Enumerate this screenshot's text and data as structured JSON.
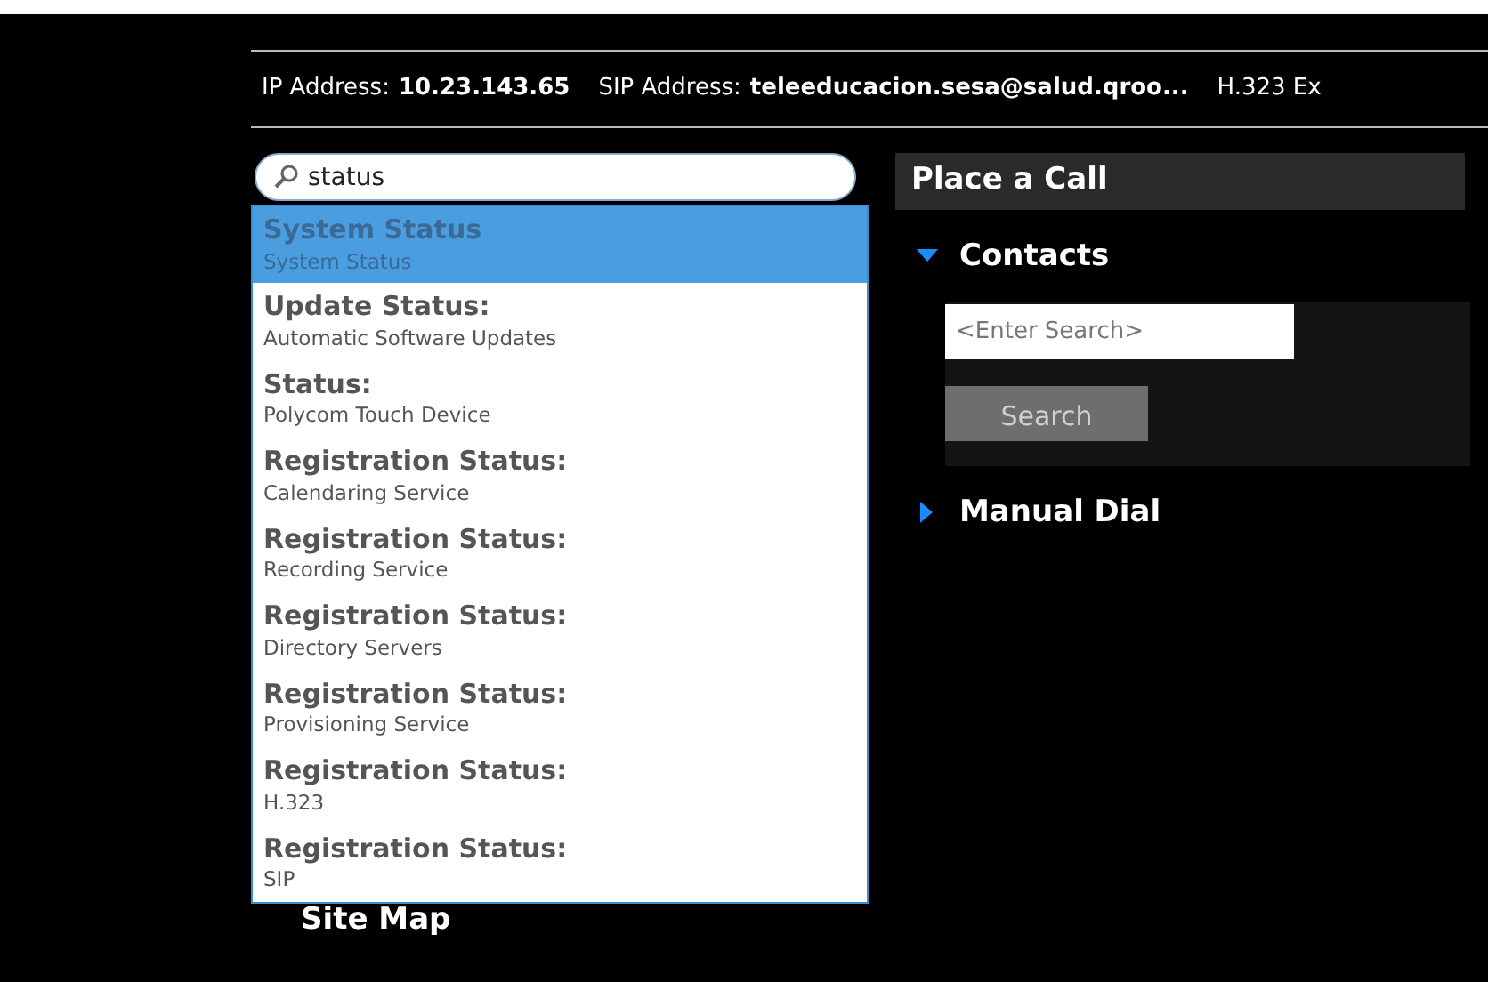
{
  "info_bar": [
    {
      "label": "IP Address:",
      "value": "10.23.143.65"
    },
    {
      "label": "SIP Address:",
      "value": "teleeducacion.sesa@salud.qroo..."
    },
    {
      "label": "H.323 Ex"
    }
  ],
  "search": {
    "value": "status"
  },
  "suggestions": [
    {
      "title": "System Status",
      "subtitle": "System Status",
      "selected": true
    },
    {
      "title": "Update Status:",
      "subtitle": "Automatic Software Updates",
      "selected": false
    },
    {
      "title": "Status:",
      "subtitle": "Polycom Touch Device",
      "selected": false
    },
    {
      "title": "Registration Status:",
      "subtitle": "Calendaring Service",
      "selected": false
    },
    {
      "title": "Registration Status:",
      "subtitle": "Recording Service",
      "selected": false
    },
    {
      "title": "Registration Status:",
      "subtitle": "Directory Servers",
      "selected": false
    },
    {
      "title": "Registration Status:",
      "subtitle": "Provisioning Service",
      "selected": false
    },
    {
      "title": "Registration Status:",
      "subtitle": "H.323",
      "selected": false
    },
    {
      "title": "Registration Status:",
      "subtitle": "SIP",
      "selected": false
    }
  ],
  "sidebar": {
    "items": [
      {
        "label": "Site Map"
      }
    ]
  },
  "place_call": {
    "title": "Place a Call",
    "sections": [
      {
        "label": "Contacts",
        "expanded": true,
        "placeholder": "<Enter Search>",
        "button": {
          "label": "Search",
          "disabled": true
        }
      },
      {
        "label": "Manual Dial",
        "expanded": false
      }
    ]
  }
}
